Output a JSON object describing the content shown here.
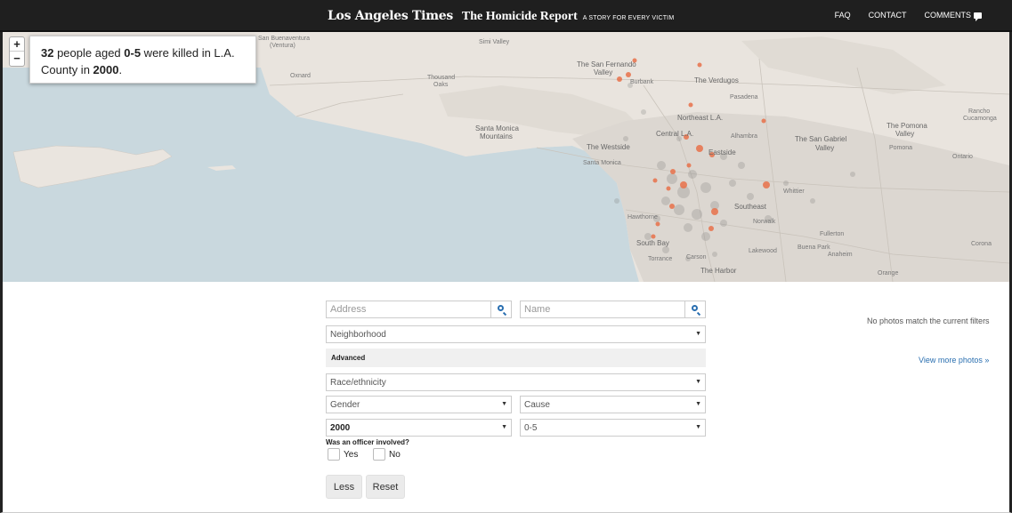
{
  "header": {
    "brand_lat": "Los Angeles Times",
    "brand_report": "The Homicide Report",
    "brand_tagline": "A STORY FOR EVERY VICTIM",
    "nav": {
      "faq": "FAQ",
      "contact": "CONTACT",
      "comments": "COMMENTS"
    }
  },
  "map": {
    "zoom_in": "+",
    "zoom_out": "−",
    "summary": {
      "count": "32",
      "text1": " people aged ",
      "age": "0-5",
      "text2": " were killed in L.A. County in ",
      "year": "2000",
      "text3": "."
    },
    "labels": {
      "san_buenaventura": "San Buenaventura",
      "ventura": "(Ventura)",
      "simi_valley": "Simi Valley",
      "oxnard": "Oxnard",
      "thousand_oaks_1": "Thousand",
      "thousand_oaks_2": "Oaks",
      "sfv_1": "The San Fernando",
      "sfv_2": "Valley",
      "burbank": "Burbank",
      "verdugos": "The Verdugos",
      "pasadena": "Pasadena",
      "northeast_la": "Northeast L.A.",
      "santa_monica_mtns_1": "Santa Monica",
      "santa_monica_mtns_2": "Mountains",
      "central_la": "Central L.A.",
      "alhambra": "Alhambra",
      "sgv_1": "The San Gabriel",
      "sgv_2": "Valley",
      "pomona_1": "The Pomona",
      "pomona_2": "Valley",
      "rancho_1": "Rancho",
      "rancho_2": "Cucamonga",
      "ontario": "Ontario",
      "pomona_city": "Pomona",
      "westside": "The Westside",
      "santa_monica": "Santa Monica",
      "eastside": "Eastside",
      "whittier": "Whittier",
      "southeast": "Southeast",
      "hawthorne": "Hawthorne",
      "norwalk": "Norwalk",
      "fullerton": "Fullerton",
      "south_bay": "South Bay",
      "torrance": "Torrance",
      "carson": "Carson",
      "lakewood": "Lakewood",
      "buena_park": "Buena Park",
      "anaheim": "Anaheim",
      "corona": "Corona",
      "the_harbor": "The Harbor",
      "orange": "Orange"
    }
  },
  "filters": {
    "address_placeholder": "Address",
    "name_placeholder": "Name",
    "neighborhood": "Neighborhood",
    "advanced": "Advanced",
    "race": "Race/ethnicity",
    "gender": "Gender",
    "cause": "Cause",
    "year": "2000",
    "age": "0-5",
    "officer_question": "Was an officer involved?",
    "yes": "Yes",
    "no": "No",
    "less_button": "Less",
    "reset_button": "Reset"
  },
  "sidebar": {
    "no_photos": "No photos match the current filters",
    "view_more": "View more photos »"
  },
  "colors": {
    "header_bg": "#1f1f1f",
    "water": "#c7d7de",
    "land": "#e7e2dc",
    "victim_dot": "#e8714a",
    "link": "#2a6fb0"
  },
  "icons": [
    "search-icon",
    "speech-bubble-icon",
    "chevron-down-icon"
  ]
}
